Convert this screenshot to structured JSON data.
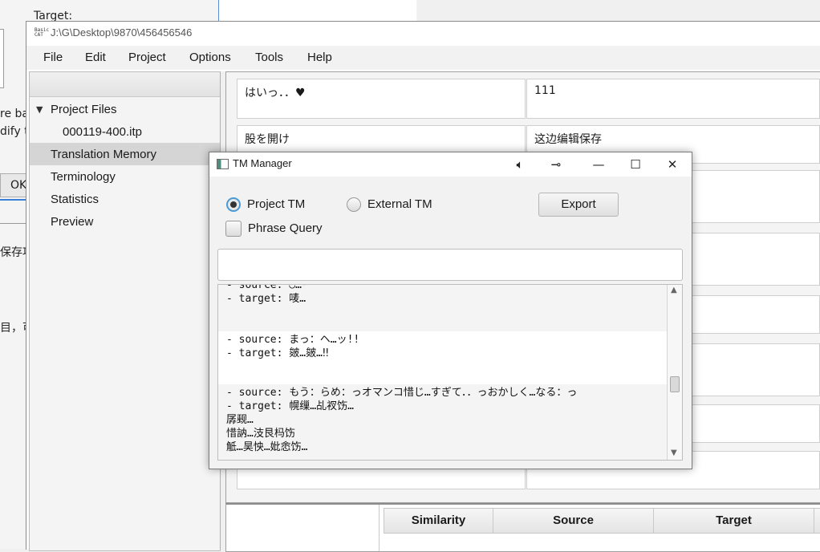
{
  "background_window": {
    "label_target": "Target:",
    "frag_1": "re bas",
    "frag_2": "dify th",
    "frag_3": "保存项",
    "frag_4": "目，可",
    "ok_label": "OK"
  },
  "main_window": {
    "title": "J:\\G\\Desktop\\9870\\456456546",
    "menu": [
      "File",
      "Edit",
      "Project",
      "Options",
      "Tools",
      "Help"
    ],
    "sidebar": {
      "root": "Project Files",
      "file": "000119-400.itp",
      "items": [
        "Translation Memory",
        "Terminology",
        "Statistics",
        "Preview"
      ],
      "selected": "Translation Memory"
    },
    "segments": [
      {
        "source": "はいっ．．♥",
        "target": "111"
      },
      {
        "source": "股を開け",
        "target": "这边编辑保存"
      }
    ],
    "match_table": {
      "headers": [
        "Similarity",
        "Source",
        "Target"
      ]
    }
  },
  "tm_dialog": {
    "title": "TM Manager",
    "radio_project": "Project TM",
    "radio_external": "External TM",
    "selected_source": "Project TM",
    "checkbox_phrase": "Phrase Query",
    "phrase_checked": false,
    "export_label": "Export",
    "query_value": "",
    "results": [
      "- source: ◡…･\n- target: 唛…",
      "- source: まっ：ヘ…ッ!!\n- target: 皴…皴…‼",
      "- source: もう：らめ：っオマンコ惜じ…すぎて．．っおかしく…なる：っ\n- target: 幌缫…乩衩饬…\n孱觋…\n惜訥…汥艮杩饬\n觝…昊怏…妣悆饬…"
    ]
  }
}
